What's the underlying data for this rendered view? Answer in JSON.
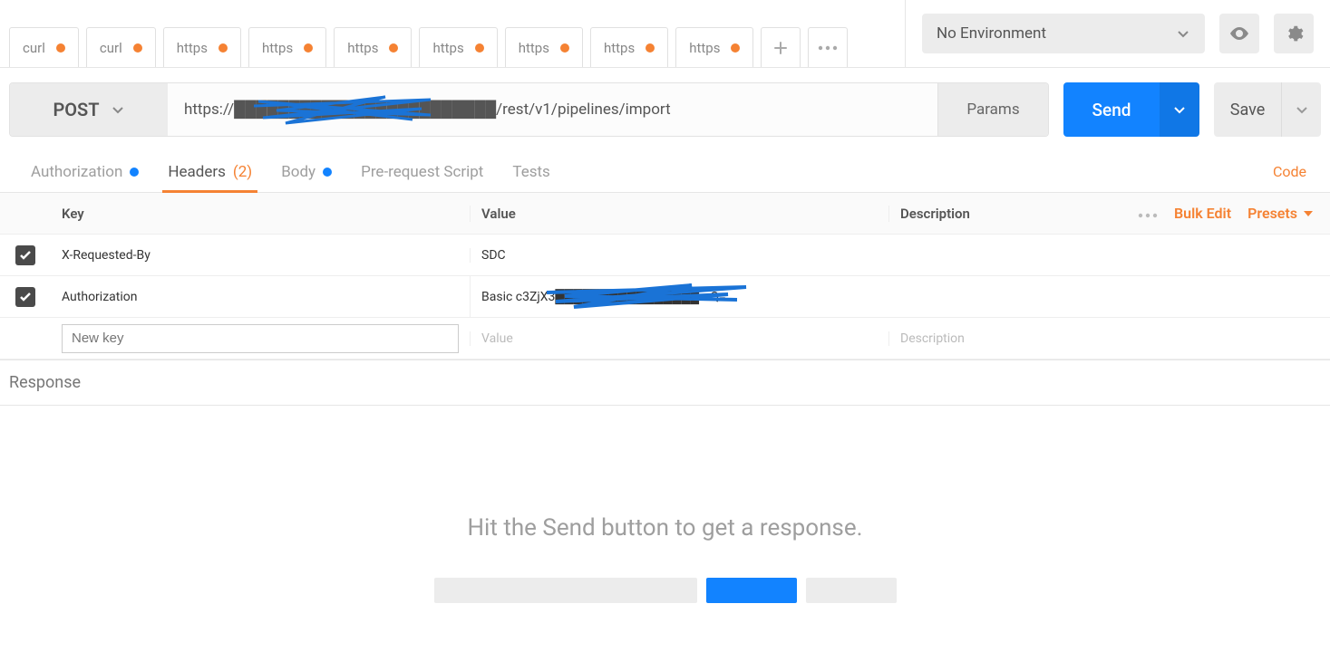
{
  "topbar": {
    "tabs": [
      {
        "label": "curl"
      },
      {
        "label": "curl"
      },
      {
        "label": "https"
      },
      {
        "label": "https"
      },
      {
        "label": "https"
      },
      {
        "label": "https"
      },
      {
        "label": "https"
      },
      {
        "label": "https"
      },
      {
        "label": "https"
      }
    ],
    "env_label": "No Environment"
  },
  "request": {
    "method": "POST",
    "url_display": "https://████████████████████████/rest/v1/pipelines/import",
    "params_label": "Params",
    "send_label": "Send",
    "save_label": "Save"
  },
  "req_tabs": {
    "authorization": "Authorization",
    "headers": "Headers",
    "headers_count": "(2)",
    "body": "Body",
    "pre_request": "Pre-request Script",
    "tests": "Tests",
    "code": "Code"
  },
  "headers_table": {
    "col_key": "Key",
    "col_value": "Value",
    "col_desc": "Description",
    "bulk_edit": "Bulk Edit",
    "presets": "Presets",
    "rows": [
      {
        "key": "X-Requested-By",
        "value": "SDC"
      },
      {
        "key": "Authorization",
        "value": "Basic c3ZjX3████████████████mQ="
      }
    ],
    "new": {
      "key_placeholder": "New key",
      "value_placeholder": "Value",
      "desc_placeholder": "Description"
    }
  },
  "response": {
    "label": "Response",
    "empty_msg": "Hit the Send button to get a response."
  }
}
